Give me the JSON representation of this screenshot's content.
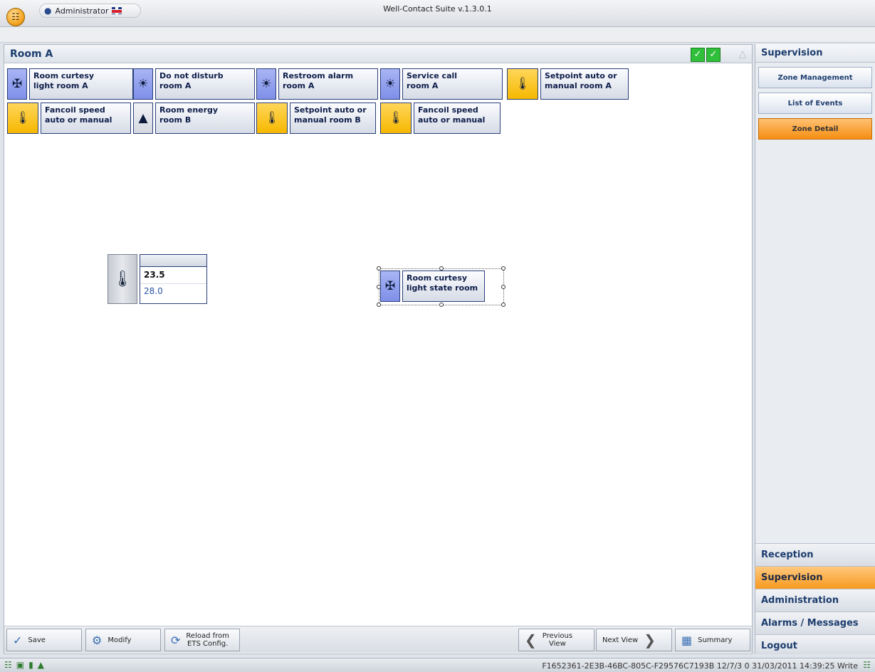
{
  "window": {
    "title": "Well-Contact Suite v.1.3.0.1",
    "user": "Administrator"
  },
  "room": {
    "title": "Room A"
  },
  "tiles": [
    {
      "label": "Room curtesy\nlight room A",
      "icon": "light-sensor-icon",
      "color": "blue"
    },
    {
      "label": "Do not disturb\nroom A",
      "icon": "lamp-bulb-icon",
      "color": "blue"
    },
    {
      "label": "Restroom alarm\nroom A",
      "icon": "lamp-bulb-icon",
      "color": "blue"
    },
    {
      "label": "Service call\nroom A",
      "icon": "lamp-bulb-icon",
      "color": "blue"
    },
    {
      "label": "Setpoint auto or\nmanual room A",
      "icon": "thermometer-hand-icon",
      "color": "yellow"
    },
    {
      "label": "Fancoil speed\nauto or manual",
      "icon": "thermometer-hand-icon",
      "color": "yellow"
    },
    {
      "label": "Room energy\nroom B",
      "icon": "lamp-icon",
      "color": "gray"
    },
    {
      "label": "Setpoint auto or\nmanual room B",
      "icon": "thermometer-hand-icon",
      "color": "yellow"
    },
    {
      "label": "Fancoil speed\nauto or manual",
      "icon": "thermometer-hand-icon",
      "color": "yellow"
    }
  ],
  "temperature": {
    "value": "23.5",
    "setpoint": "28.0"
  },
  "selected_tile": {
    "label": "Room curtesy\nlight state room"
  },
  "toolbar": {
    "save": "Save",
    "modify": "Modify",
    "reload": "Reload from\nETS Config.",
    "previous": "Previous\nView",
    "next": "Next View",
    "summary": "Summary"
  },
  "side": {
    "header": "Supervision",
    "buttons": [
      "Zone Management",
      "List of Events",
      "Zone Detail"
    ],
    "active_button": "Zone Detail",
    "categories": [
      "Reception",
      "Supervision",
      "Administration",
      "Alarms / Messages",
      "Logout"
    ],
    "active_category": "Supervision"
  },
  "status": {
    "text": "F1652361-2E3B-46BC-805C-F29576C7193B 12/7/3 0 31/03/2011 14:39:25 Write"
  },
  "colors": {
    "accent": "#f79a1f",
    "tile_blue": "#8c9bec",
    "tile_yellow": "#f6b800",
    "ok_green": "#2fbf3a"
  }
}
